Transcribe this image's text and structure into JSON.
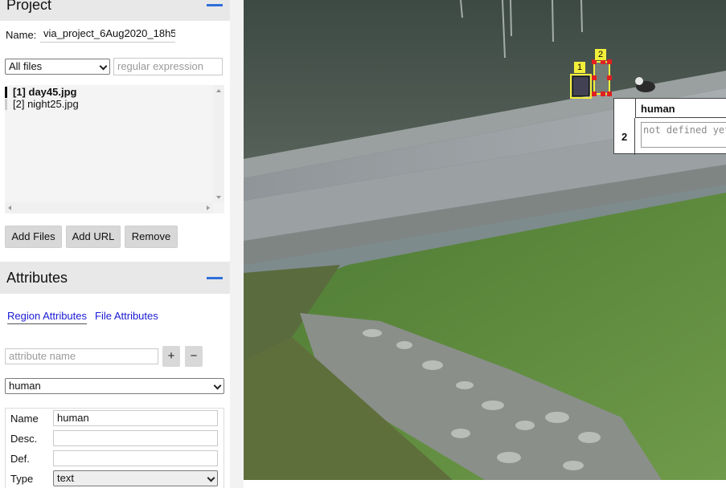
{
  "project": {
    "header": "Project",
    "name_label": "Name:",
    "name_value": "via_project_6Aug2020_18h5",
    "filter_select": "All files",
    "regex_placeholder": "regular expression",
    "files": [
      {
        "label": "[1] day45.jpg",
        "active": true
      },
      {
        "label": "[2] night25.jpg",
        "active": false
      }
    ],
    "buttons": {
      "add_files": "Add Files",
      "add_url": "Add URL",
      "remove": "Remove"
    }
  },
  "attributes": {
    "header": "Attributes",
    "tabs": {
      "region": "Region Attributes",
      "file": "File Attributes"
    },
    "name_placeholder": "attribute name",
    "add_symbol": "+",
    "remove_symbol": "−",
    "selected_attribute": "human",
    "form": {
      "name_label": "Name",
      "name_value": "human",
      "desc_label": "Desc.",
      "desc_value": "",
      "def_label": "Def.",
      "def_value": "",
      "type_label": "Type",
      "type_value": "text"
    }
  },
  "canvas": {
    "regions": [
      {
        "id": "1"
      },
      {
        "id": "2"
      }
    ],
    "popup": {
      "column_header": "human",
      "row_id": "2",
      "value_placeholder": "not defined yet"
    }
  },
  "colors": {
    "accent": "#2f6fdb",
    "region_label_bg": "#f2ee3a",
    "selected_region": "#e02020",
    "tab_link": "#1a1ad6"
  },
  "icons": {
    "collapse": "minus-bar-icon",
    "scroll_up": "arrow-up-icon",
    "scroll_down": "arrow-down-icon",
    "scroll_left": "arrow-left-icon",
    "scroll_right": "arrow-right-icon",
    "dropdown": "chevron-down-icon"
  }
}
